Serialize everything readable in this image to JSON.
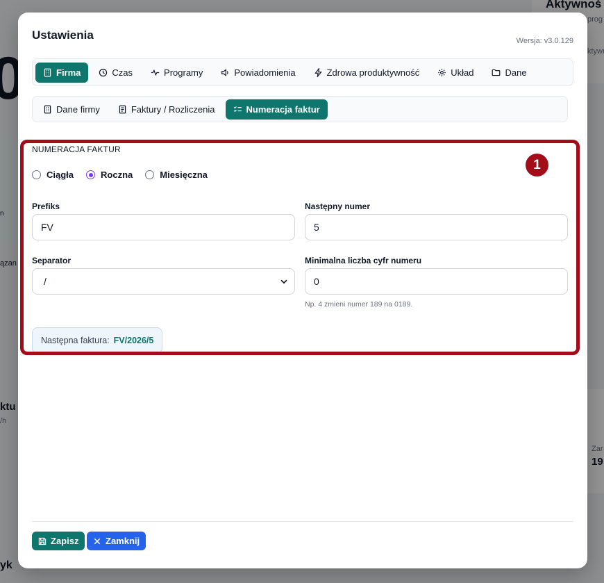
{
  "background": {
    "top_right_heading": "Aktywnoś",
    "top_right_sub": "prog",
    "top_right_sub2": "ktywn",
    "big_char": "0",
    "left_frag1": "n",
    "left_frag2": "ązan",
    "left_frag3": "ktu",
    "left_frag4": "/h",
    "right_frag1": "Zar",
    "right_frag2": "19",
    "bottom_left": "yk"
  },
  "modal": {
    "title": "Ustawienia",
    "version": "Wersja: v3.0.129"
  },
  "tabs": [
    {
      "label": "Firma",
      "icon": "building-icon",
      "active": true
    },
    {
      "label": "Czas",
      "icon": "clock-icon",
      "active": false
    },
    {
      "label": "Programy",
      "icon": "activity-icon",
      "active": false
    },
    {
      "label": "Powiadomienia",
      "icon": "speaker-icon",
      "active": false
    },
    {
      "label": "Zdrowa produktywność",
      "icon": "bolt-icon",
      "active": false
    },
    {
      "label": "Układ",
      "icon": "gear-icon",
      "active": false
    },
    {
      "label": "Dane",
      "icon": "folder-icon",
      "active": false
    }
  ],
  "subtabs": [
    {
      "label": "Dane firmy",
      "icon": "building-icon",
      "active": false
    },
    {
      "label": "Faktury / Rozliczenia",
      "icon": "document-icon",
      "active": false
    },
    {
      "label": "Numeracja faktur",
      "icon": "list-check-icon",
      "active": true
    }
  ],
  "numbering": {
    "section_title": "NUMERACJA FAKTUR",
    "modes": [
      {
        "label": "Ciągła",
        "checked": false
      },
      {
        "label": "Roczna",
        "checked": true
      },
      {
        "label": "Miesięczna",
        "checked": false
      }
    ],
    "prefix_label": "Prefiks",
    "prefix_value": "FV",
    "next_label": "Następny numer",
    "next_value": "5",
    "separator_label": "Separator",
    "separator_value": "/",
    "min_digits_label": "Minimalna liczba cyfr numeru",
    "min_digits_value": "0",
    "min_digits_hint": "Np. 4 zmieni numer 189 na 0189.",
    "preview_label": "Następna faktura:",
    "preview_value": "FV/2026/5"
  },
  "annotation": {
    "badge": "1",
    "color": "#a30d1a"
  },
  "footer": {
    "save_label": "Zapisz",
    "close_label": "Zamknij"
  },
  "colors": {
    "primary": "#0f766e",
    "secondary": "#2563eb",
    "radio": "#7c3aed"
  }
}
